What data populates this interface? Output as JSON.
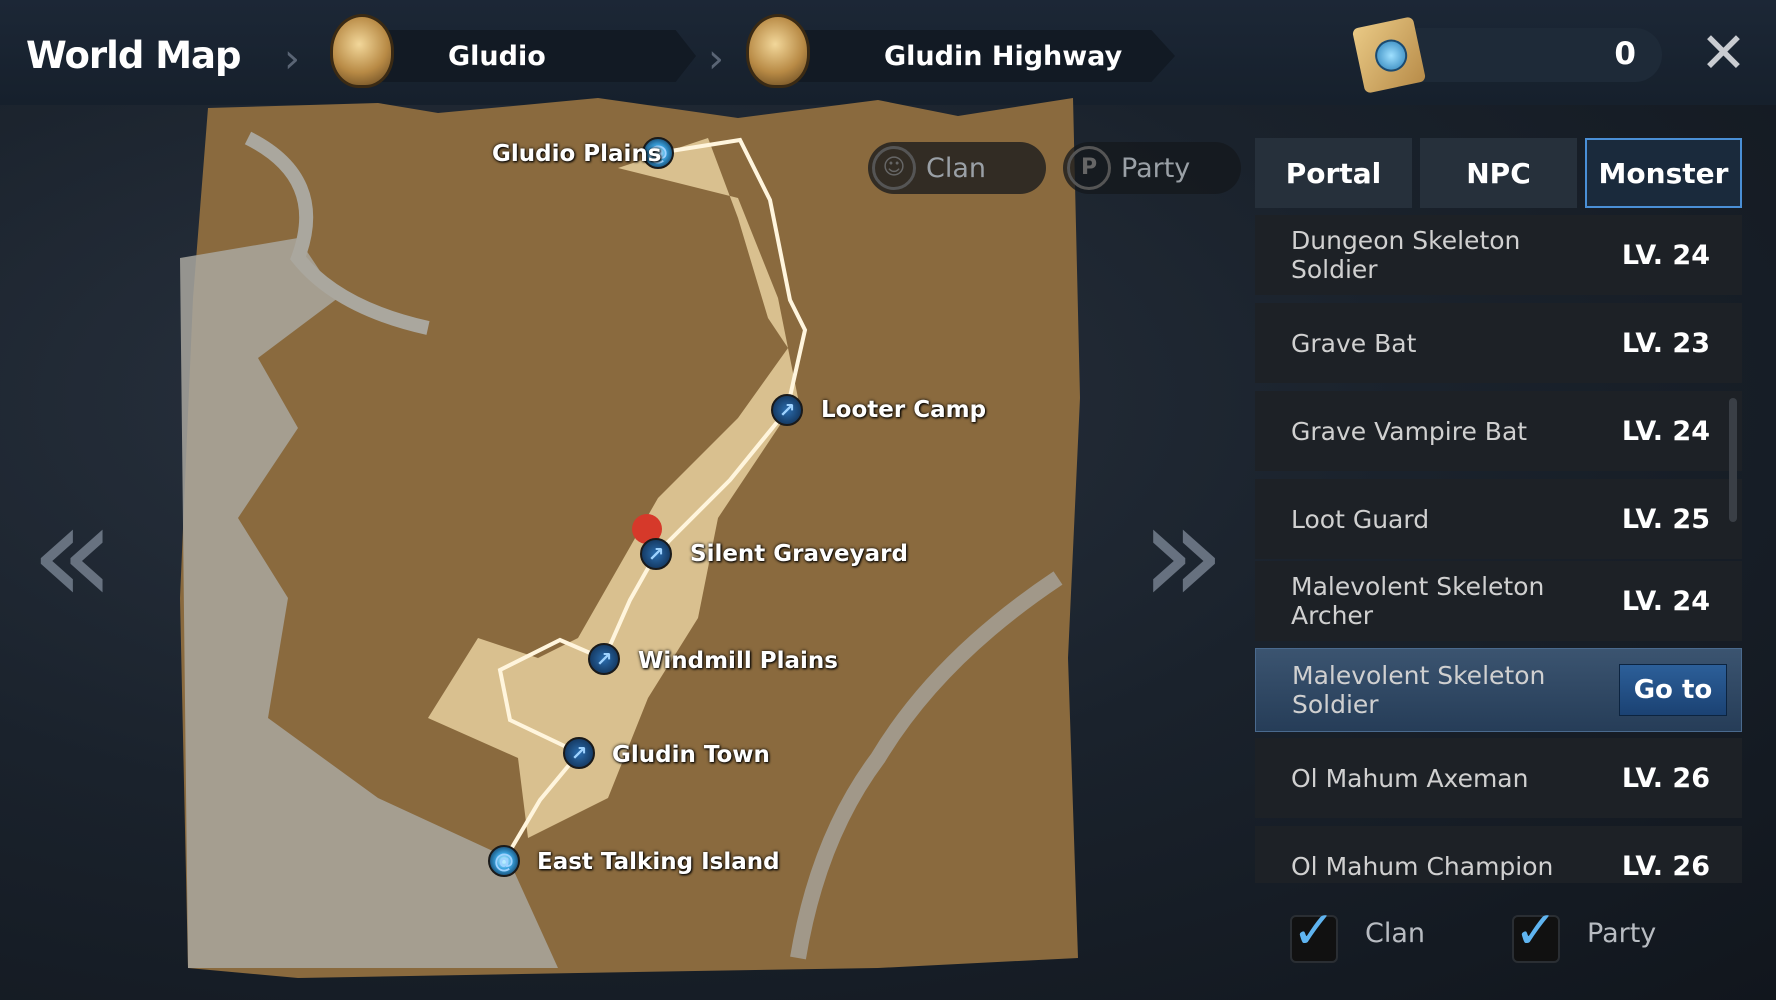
{
  "header": {
    "title": "World Map",
    "breadcrumb": [
      {
        "label": "Gludio",
        "icon": "castle-icon"
      },
      {
        "label": "Gludin Highway",
        "icon": "tower-icon"
      }
    ],
    "currency_value": "0",
    "currency_icon": "teleport-scroll-icon",
    "close_icon": "close-icon"
  },
  "map": {
    "filters": [
      {
        "label": "Clan",
        "icon": "clan-icon"
      },
      {
        "label": "Party",
        "icon": "party-icon"
      }
    ],
    "locations": [
      {
        "label": "Gludio Plains",
        "type": "portal"
      },
      {
        "label": "Looter Camp",
        "type": "waypoint"
      },
      {
        "label": "Silent Graveyard",
        "type": "waypoint"
      },
      {
        "label": "Windmill Plains",
        "type": "waypoint"
      },
      {
        "label": "Gludin Town",
        "type": "waypoint"
      },
      {
        "label": "East Talking Island",
        "type": "portal"
      }
    ],
    "player_marker_color": "#d6392a"
  },
  "panel": {
    "tabs": [
      {
        "label": "Portal"
      },
      {
        "label": "NPC"
      },
      {
        "label": "Monster",
        "active": true
      }
    ],
    "monsters": [
      {
        "name": "Dungeon Skeleton Soldier",
        "level": "LV. 24"
      },
      {
        "name": "Grave Bat",
        "level": "LV. 23"
      },
      {
        "name": "Grave Vampire Bat",
        "level": "LV. 24"
      },
      {
        "name": "Loot Guard",
        "level": "LV. 25"
      },
      {
        "name": "Malevolent Skeleton Archer",
        "level": "LV. 24"
      },
      {
        "name": "Malevolent Skeleton Soldier",
        "level": "",
        "selected": true
      },
      {
        "name": "Ol Mahum Axeman",
        "level": "LV. 26"
      },
      {
        "name": "Ol Mahum Champion",
        "level": "LV. 26"
      }
    ],
    "goto_label": "Go to",
    "checkboxes": [
      {
        "label": "Clan",
        "checked": true
      },
      {
        "label": "Party",
        "checked": true
      }
    ]
  },
  "colors": {
    "accent": "#4a8fd6",
    "selected_row": "#3b5470",
    "goto_button": "#2c5f99"
  }
}
